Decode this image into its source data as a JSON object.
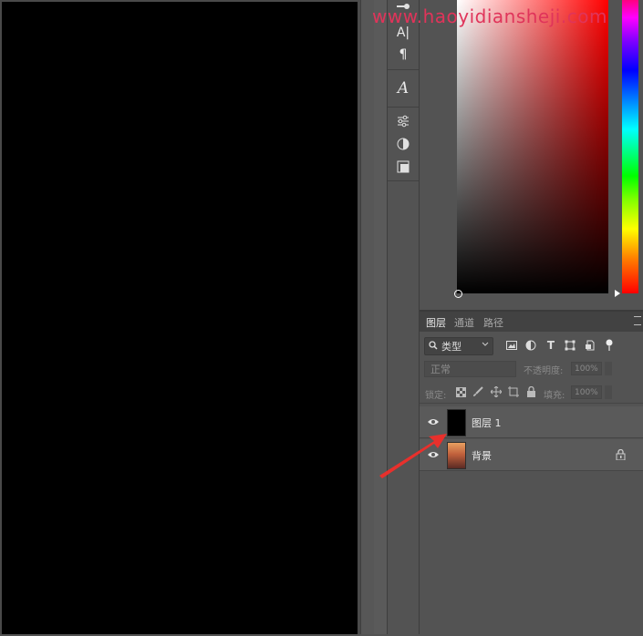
{
  "watermark": "www.haoyidiansheji.com",
  "colors": {
    "accent": "#e8302c",
    "watermark": "#e0345a",
    "panel_bg": "#535353",
    "canvas": "#000000"
  },
  "color_picker": {
    "hue": "#ff0000"
  },
  "toolstrip": {
    "tools": [
      "character-panel-icon",
      "paragraph-panel-icon",
      "glyphs-icon",
      "adjustments-icon",
      "styles-icon",
      "libraries-icon"
    ],
    "labels": {
      "char": "A|",
      "para": "¶",
      "glyph": "A"
    }
  },
  "layers_panel": {
    "tabs": [
      {
        "label": "图层",
        "active": true
      },
      {
        "label": "通道",
        "active": false
      },
      {
        "label": "路径",
        "active": false
      }
    ],
    "filter": {
      "kind_label": "类型"
    },
    "blend_mode": "正常",
    "opacity_label": "不透明度:",
    "opacity_value": "100%",
    "lock_label": "锁定:",
    "fill_label": "填充:",
    "fill_value": "100%",
    "layers": [
      {
        "name": "图层 1",
        "thumb_color": "#000000",
        "visible": true,
        "locked": false
      },
      {
        "name": "背景",
        "thumb_color": "#b25a3a",
        "visible": true,
        "locked": true
      }
    ]
  }
}
